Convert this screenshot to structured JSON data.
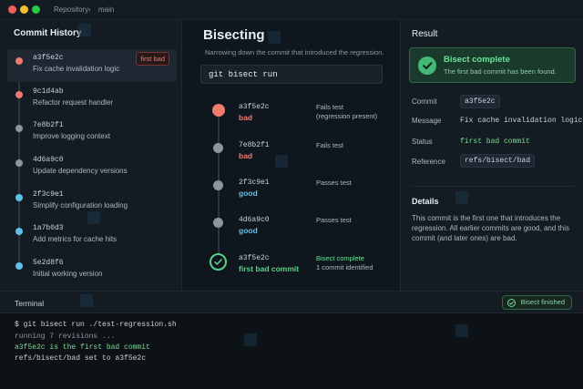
{
  "titlebar": {
    "repo": "Repository",
    "sep": "›",
    "branch": "main"
  },
  "commit_history": {
    "title": "Commit History",
    "items": [
      {
        "sha": "a3f5e2c",
        "message": "Fix cache invalidation logic",
        "badge": "first bad",
        "dot_color": "#f07a6c",
        "selected": true
      },
      {
        "sha": "9c1d4ab",
        "message": "Refactor request handler",
        "dot_color": "#f07a6c"
      },
      {
        "sha": "7e8b2f1",
        "message": "Improve logging context",
        "dot_color": "#8b96a3"
      },
      {
        "sha": "4d6a9c0",
        "message": "Update dependency versions",
        "dot_color": "#8b96a3"
      },
      {
        "sha": "2f3c9e1",
        "message": "Simplify configuration loading",
        "dot_color": "#5fc0e8"
      },
      {
        "sha": "1a7b0d3",
        "message": "Add metrics for cache hits",
        "dot_color": "#5fc0e8"
      },
      {
        "sha": "5e2d8f6",
        "message": "Initial working version",
        "dot_color": "#5fc0e8"
      }
    ]
  },
  "bisect": {
    "title": "Bisecting",
    "subtitle": "Narrowing down the commit that introduced the regression.",
    "command": "git bisect run",
    "steps": [
      {
        "sha": "a3f5e2c",
        "state": "bad",
        "note": "Fails test",
        "note2": "(regression present)",
        "kind": "bad",
        "dot_color": "#f07a6c"
      },
      {
        "sha": "7e8b2f1",
        "state": "bad",
        "note": "Fails test",
        "kind": "bad",
        "dot_color": "#8b96a3"
      },
      {
        "sha": "2f3c9e1",
        "state": "good",
        "note": "Passes test",
        "kind": "good",
        "dot_color": "#8b96a3"
      },
      {
        "sha": "4d6a9c0",
        "state": "good",
        "note": "Passes test",
        "kind": "good",
        "dot_color": "#8b96a3"
      },
      {
        "sha": "a3f5e2c",
        "state": "first bad commit",
        "note": "Bisect complete",
        "note2": "1 commit identified",
        "kind": "firstbad",
        "dot_color": "#5cd08a"
      }
    ]
  },
  "result": {
    "title": "Result",
    "status_title": "Bisect complete",
    "status_sub": "The first bad commit has been found.",
    "commit_label": "Commit",
    "commit_value": "a3f5e2c",
    "message_label": "Message",
    "message_value": "Fix cache invalidation logic",
    "status_label": "Status",
    "status_value": "first bad commit",
    "reference_label": "Reference",
    "reference_value": "refs/bisect/bad",
    "details_title": "Details",
    "details_text": "This commit is the first one that introduces the regression. All earlier commits are good, and this commit (and later ones) are bad."
  },
  "terminal": {
    "title": "Terminal",
    "badge": "Bisect finished",
    "lines": [
      "$ git bisect run ./test-regression.sh",
      "running 7 revisions ...",
      "a3f5e2c is the first bad commit",
      "refs/bisect/bad set to a3f5e2c"
    ]
  }
}
